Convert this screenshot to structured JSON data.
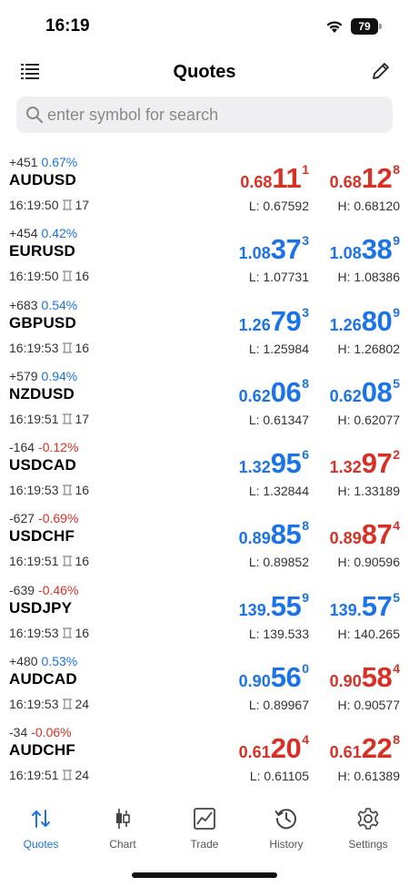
{
  "status_bar": {
    "time": "16:19",
    "battery": "79"
  },
  "header": {
    "title": "Quotes",
    "left_icon": "list-icon",
    "right_icon": "edit-icon"
  },
  "search": {
    "placeholder": "enter symbol for search",
    "value": ""
  },
  "colors": {
    "up": "#1a73e8",
    "down": "#d93025"
  },
  "quotes": [
    {
      "change_points": "+451",
      "change_pct": "0.67%",
      "change_dir": "up",
      "symbol": "AUDUSD",
      "time": "16:19:50",
      "spread": "17",
      "bid": {
        "small": "0.68",
        "big": "11",
        "sup": "1",
        "dir": "down"
      },
      "ask": {
        "small": "0.68",
        "big": "12",
        "sup": "8",
        "dir": "down"
      },
      "low": "L: 0.67592",
      "high": "H: 0.68120"
    },
    {
      "change_points": "+454",
      "change_pct": "0.42%",
      "change_dir": "up",
      "symbol": "EURUSD",
      "time": "16:19:50",
      "spread": "16",
      "bid": {
        "small": "1.08",
        "big": "37",
        "sup": "3",
        "dir": "up"
      },
      "ask": {
        "small": "1.08",
        "big": "38",
        "sup": "9",
        "dir": "up"
      },
      "low": "L: 1.07731",
      "high": "H: 1.08386"
    },
    {
      "change_points": "+683",
      "change_pct": "0.54%",
      "change_dir": "up",
      "symbol": "GBPUSD",
      "time": "16:19:53",
      "spread": "16",
      "bid": {
        "small": "1.26",
        "big": "79",
        "sup": "3",
        "dir": "up"
      },
      "ask": {
        "small": "1.26",
        "big": "80",
        "sup": "9",
        "dir": "up"
      },
      "low": "L: 1.25984",
      "high": "H: 1.26802"
    },
    {
      "change_points": "+579",
      "change_pct": "0.94%",
      "change_dir": "up",
      "symbol": "NZDUSD",
      "time": "16:19:51",
      "spread": "17",
      "bid": {
        "small": "0.62",
        "big": "06",
        "sup": "8",
        "dir": "up"
      },
      "ask": {
        "small": "0.62",
        "big": "08",
        "sup": "5",
        "dir": "up"
      },
      "low": "L: 0.61347",
      "high": "H: 0.62077"
    },
    {
      "change_points": "-164",
      "change_pct": "-0.12%",
      "change_dir": "down",
      "symbol": "USDCAD",
      "time": "16:19:53",
      "spread": "16",
      "bid": {
        "small": "1.32",
        "big": "95",
        "sup": "6",
        "dir": "up"
      },
      "ask": {
        "small": "1.32",
        "big": "97",
        "sup": "2",
        "dir": "down"
      },
      "low": "L: 1.32844",
      "high": "H: 1.33189"
    },
    {
      "change_points": "-627",
      "change_pct": "-0.69%",
      "change_dir": "down",
      "symbol": "USDCHF",
      "time": "16:19:51",
      "spread": "16",
      "bid": {
        "small": "0.89",
        "big": "85",
        "sup": "8",
        "dir": "up"
      },
      "ask": {
        "small": "0.89",
        "big": "87",
        "sup": "4",
        "dir": "down"
      },
      "low": "L: 0.89852",
      "high": "H: 0.90596"
    },
    {
      "change_points": "-639",
      "change_pct": "-0.46%",
      "change_dir": "down",
      "symbol": "USDJPY",
      "time": "16:19:53",
      "spread": "16",
      "bid": {
        "small": "139.",
        "big": "55",
        "sup": "9",
        "dir": "up"
      },
      "ask": {
        "small": "139.",
        "big": "57",
        "sup": "5",
        "dir": "up"
      },
      "low": "L: 139.533",
      "high": "H: 140.265"
    },
    {
      "change_points": "+480",
      "change_pct": "0.53%",
      "change_dir": "up",
      "symbol": "AUDCAD",
      "time": "16:19:53",
      "spread": "24",
      "bid": {
        "small": "0.90",
        "big": "56",
        "sup": "0",
        "dir": "up"
      },
      "ask": {
        "small": "0.90",
        "big": "58",
        "sup": "4",
        "dir": "down"
      },
      "low": "L: 0.89967",
      "high": "H: 0.90577"
    },
    {
      "change_points": "-34",
      "change_pct": "-0.06%",
      "change_dir": "down",
      "symbol": "AUDCHF",
      "time": "16:19:51",
      "spread": "24",
      "bid": {
        "small": "0.61",
        "big": "20",
        "sup": "4",
        "dir": "down"
      },
      "ask": {
        "small": "0.61",
        "big": "22",
        "sup": "8",
        "dir": "down"
      },
      "low": "L: 0.61105",
      "high": "H: 0.61389"
    }
  ],
  "tabs": [
    {
      "label": "Quotes",
      "icon": "quotes-icon",
      "active": true
    },
    {
      "label": "Chart",
      "icon": "chart-icon",
      "active": false
    },
    {
      "label": "Trade",
      "icon": "trade-icon",
      "active": false
    },
    {
      "label": "History",
      "icon": "history-icon",
      "active": false
    },
    {
      "label": "Settings",
      "icon": "settings-icon",
      "active": false
    }
  ]
}
